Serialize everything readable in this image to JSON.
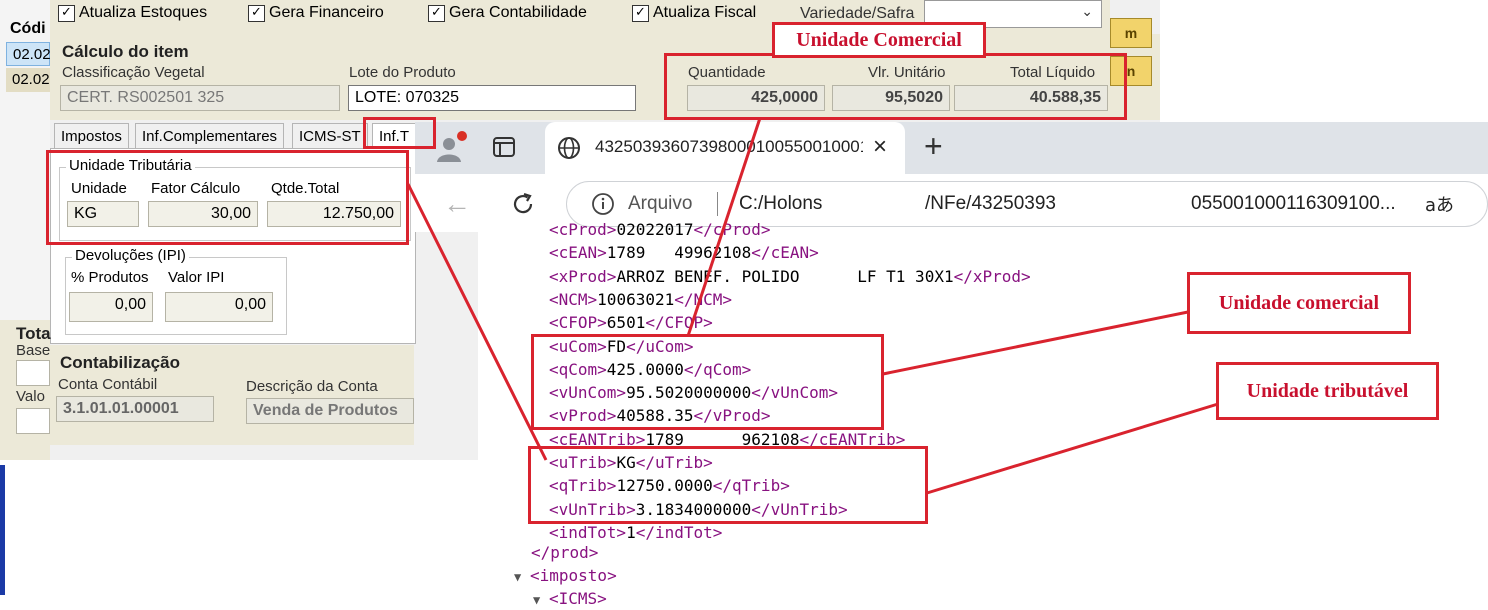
{
  "erp": {
    "list": {
      "header": "Códi",
      "rows": [
        "02.02",
        "02.02"
      ]
    },
    "checkboxes": [
      {
        "label": "Atualiza Estoques",
        "checked": true
      },
      {
        "label": "Gera Financeiro",
        "checked": true
      },
      {
        "label": "Gera Contabilidade",
        "checked": true
      },
      {
        "label": "Atualiza Fiscal",
        "checked": true
      }
    ],
    "variedade_label": "Variedade/Safra",
    "calculo": {
      "title": "Cálculo do item",
      "classificacao_label": "Classificação Vegetal",
      "classificacao_value": "CERT. RS002501              325",
      "lote_label": "Lote do Produto",
      "lote_value": "LOTE: 070325",
      "quantidade_label": "Quantidade",
      "quantidade_value": "425,0000",
      "vlr_unit_label": "Vlr. Unitário",
      "vlr_unit_value": "95,5020",
      "total_label": "Total Líquido",
      "total_value": "40.588,35"
    },
    "side_buttons": [
      "m",
      "n"
    ],
    "tabs": [
      "Impostos",
      "Inf.Complementares",
      "ICMS-ST",
      "Inf.T"
    ],
    "unidade_tributaria": {
      "title": "Unidade Tributária",
      "unidade_label": "Unidade",
      "unidade_value": "KG",
      "fator_label": "Fator Cálculo",
      "fator_value": "30,00",
      "qtde_label": "Qtde.Total",
      "qtde_value": "12.750,00"
    },
    "devolucoes": {
      "title": "Devoluções (IPI)",
      "produtos_label": "% Produtos",
      "produtos_value": "0,00",
      "ipi_label": "Valor IPI",
      "ipi_value": "0,00"
    },
    "totais": {
      "title": "Tota",
      "base_label": "Base",
      "valor_label": "Valo"
    },
    "contabilizacao": {
      "title": "Contabilização",
      "conta_label": "Conta Contábil",
      "conta_value": "3.1.01.01.00001",
      "descricao_label": "Descrição da Conta",
      "descricao_value": "Venda de Produtos"
    }
  },
  "browser": {
    "tab_title": "43250393607398000100550010001",
    "scheme_label": "Arquivo",
    "url_part1": "C:/Holons",
    "url_part2": "/NFe/43250393",
    "url_part3": "055001000116309100...",
    "reader_icon_text": "aあ"
  },
  "xml_lines": [
    {
      "tag": "cProd",
      "value": "02022017"
    },
    {
      "tag": "cEAN",
      "value": "1789   49962108"
    },
    {
      "tag": "xProd",
      "value": "ARROZ BENEF. POLIDO      LF T1 30X1"
    },
    {
      "tag": "NCM",
      "value": "10063021"
    },
    {
      "tag": "CFOP",
      "value": "6501"
    },
    {
      "tag": "uCom",
      "value": "FD"
    },
    {
      "tag": "qCom",
      "value": "425.0000"
    },
    {
      "tag": "vUnCom",
      "value": "95.5020000000"
    },
    {
      "tag": "vProd",
      "value": "40588.35"
    },
    {
      "tag": "cEANTrib",
      "value": "1789      962108"
    },
    {
      "tag": "uTrib",
      "value": "KG"
    },
    {
      "tag": "qTrib",
      "value": "12750.0000"
    },
    {
      "tag": "vUnTrib",
      "value": "3.1834000000"
    },
    {
      "tag": "indTot",
      "value": "1"
    }
  ],
  "xml_close_prod": "</prod>",
  "xml_imposto": "<imposto>",
  "xml_icms": "<ICMS>",
  "annotations": {
    "unidade_comercial_top": "Unidade Comercial",
    "unidade_comercial": "Unidade comercial",
    "unidade_tributavel": "Unidade tributável"
  },
  "colors": {
    "annotation_red": "#d9232e",
    "xml_tag": "#881280"
  }
}
